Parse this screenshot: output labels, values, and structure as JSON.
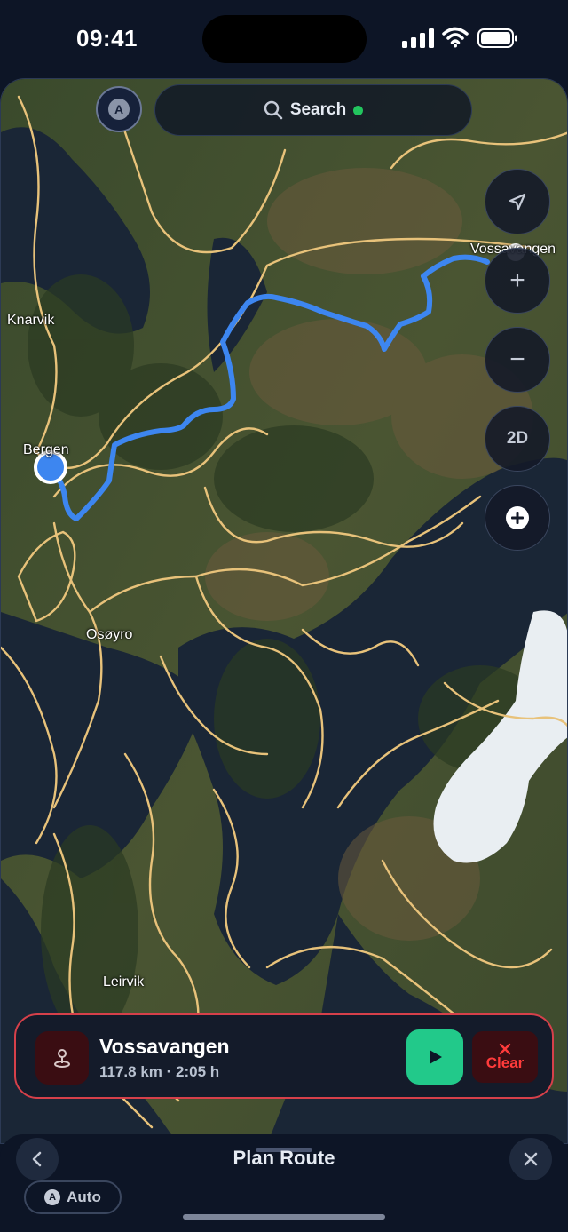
{
  "status_bar": {
    "time": "09:41"
  },
  "map": {
    "labels": {
      "knarvik": "Knarvik",
      "bergen": "Bergen",
      "osoyro": "Osøyro",
      "leirvik": "Leirvik",
      "voss": "Vossavangen"
    }
  },
  "top": {
    "avatar_letter": "A",
    "search_label": "Search"
  },
  "map_controls": {
    "zoom_in": "+",
    "zoom_out": "−",
    "view_mode": "2D",
    "add": "+"
  },
  "route": {
    "destination": "Vossavangen",
    "summary": "117.8 km · 2:05 h",
    "clear_label": "Clear"
  },
  "bottom_sheet": {
    "title": "Plan Route",
    "mode_letter": "A",
    "mode_label": "Auto"
  },
  "colors": {
    "route_line": "#3d86f0",
    "roads": "#e8c27a",
    "clear_red": "#ff3b3b",
    "start_green": "#22c98a",
    "search_dot": "#22c55e"
  }
}
